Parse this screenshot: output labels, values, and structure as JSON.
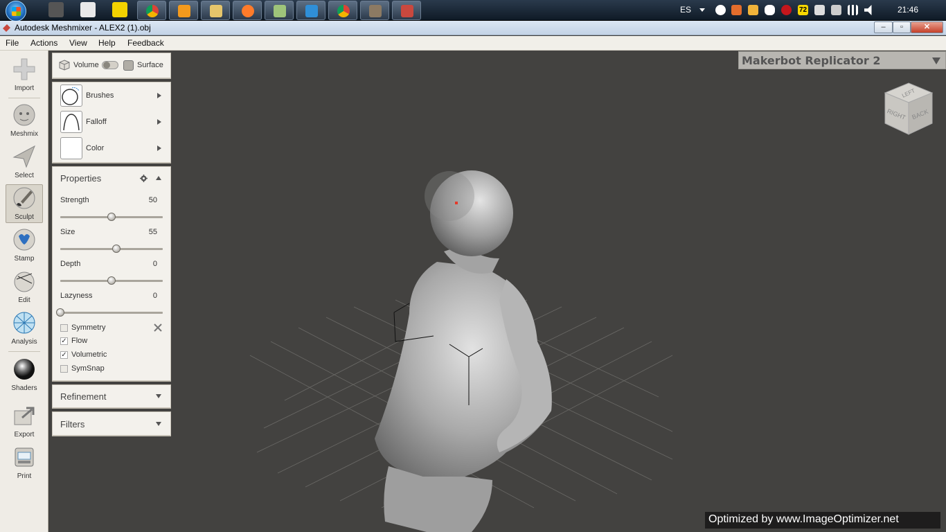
{
  "taskbar": {
    "language": "ES",
    "time": "21:46",
    "badge_count": "72"
  },
  "window": {
    "title": "Autodesk Meshmixer - ALEX2 (1).obj",
    "minimize": "–",
    "maximize": "▫",
    "close": "✕"
  },
  "menu": {
    "file": "File",
    "actions": "Actions",
    "view": "View",
    "help": "Help",
    "feedback": "Feedback"
  },
  "toolbar": {
    "import": "Import",
    "meshmix": "Meshmix",
    "select": "Select",
    "sculpt": "Sculpt",
    "stamp": "Stamp",
    "edit": "Edit",
    "analysis": "Analysis",
    "shaders": "Shaders",
    "export": "Export",
    "print": "Print"
  },
  "mode": {
    "volume": "Volume",
    "surface": "Surface"
  },
  "brush_panel": {
    "brushes": "Brushes",
    "falloff": "Falloff",
    "color": "Color"
  },
  "properties": {
    "title": "Properties",
    "strength_label": "Strength",
    "strength_value": "50",
    "strength_fraction": 0.5,
    "size_label": "Size",
    "size_value": "55",
    "size_fraction": 0.55,
    "depth_label": "Depth",
    "depth_value": "0",
    "depth_fraction": 0.5,
    "lazyness_label": "Lazyness",
    "lazyness_value": "0",
    "lazyness_fraction": 0.0,
    "symmetry": "Symmetry",
    "flow": "Flow",
    "volumetric": "Volumetric",
    "symsnap": "SymSnap",
    "flow_checked": true,
    "volumetric_checked": true
  },
  "refinement": {
    "title": "Refinement"
  },
  "filters": {
    "title": "Filters"
  },
  "printer": {
    "name": "Makerbot Replicator 2"
  },
  "viewcube": {
    "top": "LEFT",
    "right": "BACK",
    "front": "RIGHT"
  },
  "watermark": "Optimized by www.ImageOptimizer.net",
  "colors": {
    "viewport_bg": "#434240",
    "panel_bg": "#f3f1ec",
    "model_gray": "#bdbdbd"
  }
}
